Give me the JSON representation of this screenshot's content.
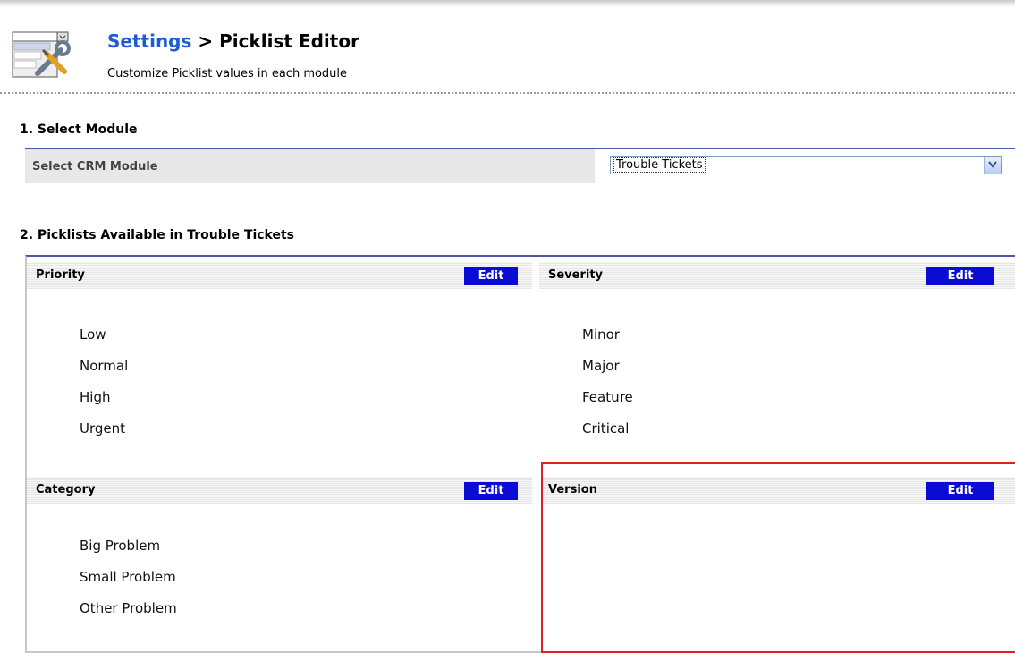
{
  "header": {
    "breadcrumb_root": "Settings",
    "separator": ">",
    "title": "Picklist Editor",
    "subtitle": "Customize Picklist values in each module",
    "icon": "settings-tools-icon"
  },
  "select_module": {
    "heading": "1. Select Module",
    "label": "Select CRM Module",
    "selected_value": "Trouble Tickets"
  },
  "picklists": {
    "heading": "2. Picklists Available in Trouble Tickets",
    "edit_label": "Edit",
    "items": [
      {
        "name": "Priority",
        "values": [
          "Low",
          "Normal",
          "High",
          "Urgent"
        ]
      },
      {
        "name": "Severity",
        "values": [
          "Minor",
          "Major",
          "Feature",
          "Critical"
        ]
      },
      {
        "name": "Category",
        "values": [
          "Big Problem",
          "Small Problem",
          "Other Problem"
        ]
      },
      {
        "name": "Version",
        "values": []
      }
    ]
  },
  "colors": {
    "link_blue": "#1e5bd6",
    "edit_button": "#0b0bd6",
    "table_border": "#4c55a8",
    "highlight_red": "#e02020"
  }
}
